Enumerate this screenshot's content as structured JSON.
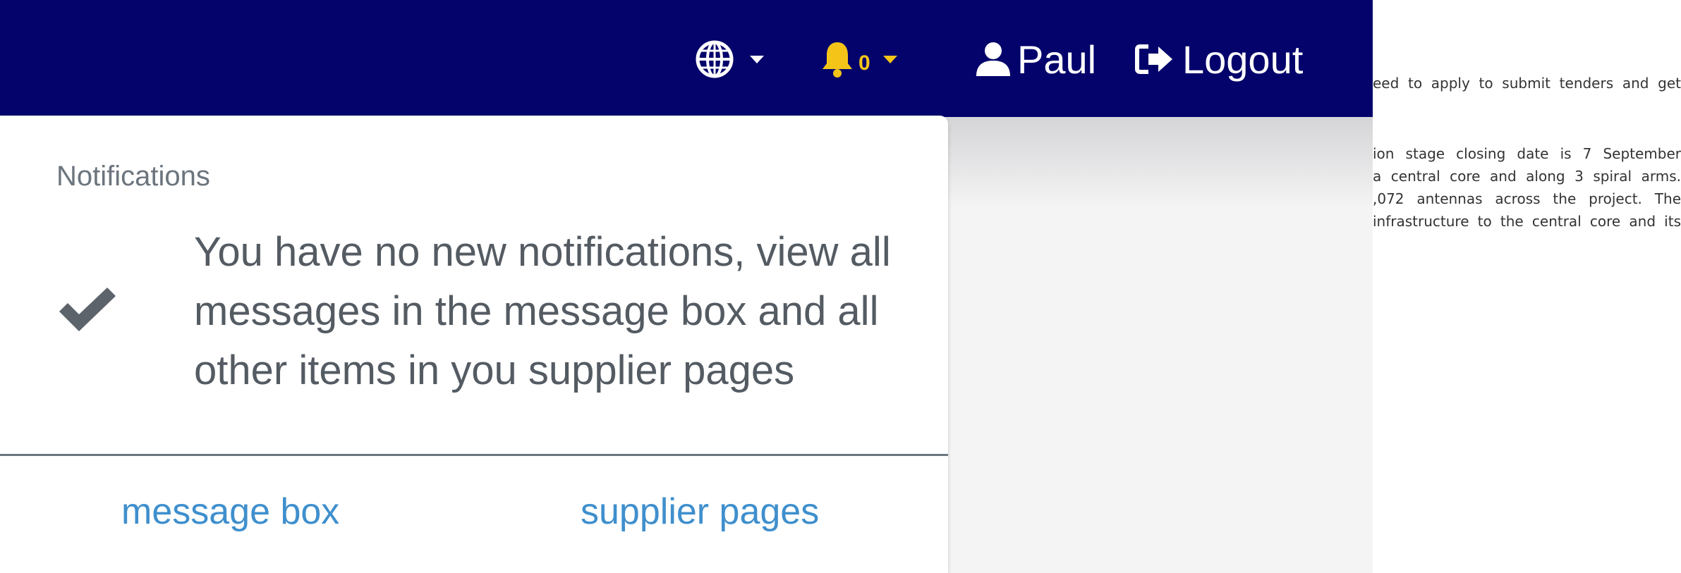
{
  "navbar": {
    "language_icon": "globe-icon",
    "notifications_icon": "bell-icon",
    "notification_count": "0",
    "user_icon": "user-icon",
    "user_name": "Paul",
    "logout_icon": "sign-out-icon",
    "logout_label": "Logout",
    "colors": {
      "background": "#03036b",
      "bell": "#f5c419"
    }
  },
  "notifications": {
    "header": "Notifications",
    "status_icon": "check-icon",
    "message_lines": [
      "You have no new notifications, view all",
      "messages in the message box and all",
      "other items in you supplier pages"
    ],
    "links": {
      "message_box": "message box",
      "supplier_pages": "supplier pages"
    },
    "colors": {
      "link": "#3f8fcd",
      "text": "#545b62"
    }
  },
  "article": {
    "lines": [
      "eed to apply to submit tenders and get",
      "ion stage closing date is 7 September",
      " a central core and along 3 spiral arms.",
      ",072 antennas across the project. The",
      " infrastructure to the central core and its"
    ]
  }
}
